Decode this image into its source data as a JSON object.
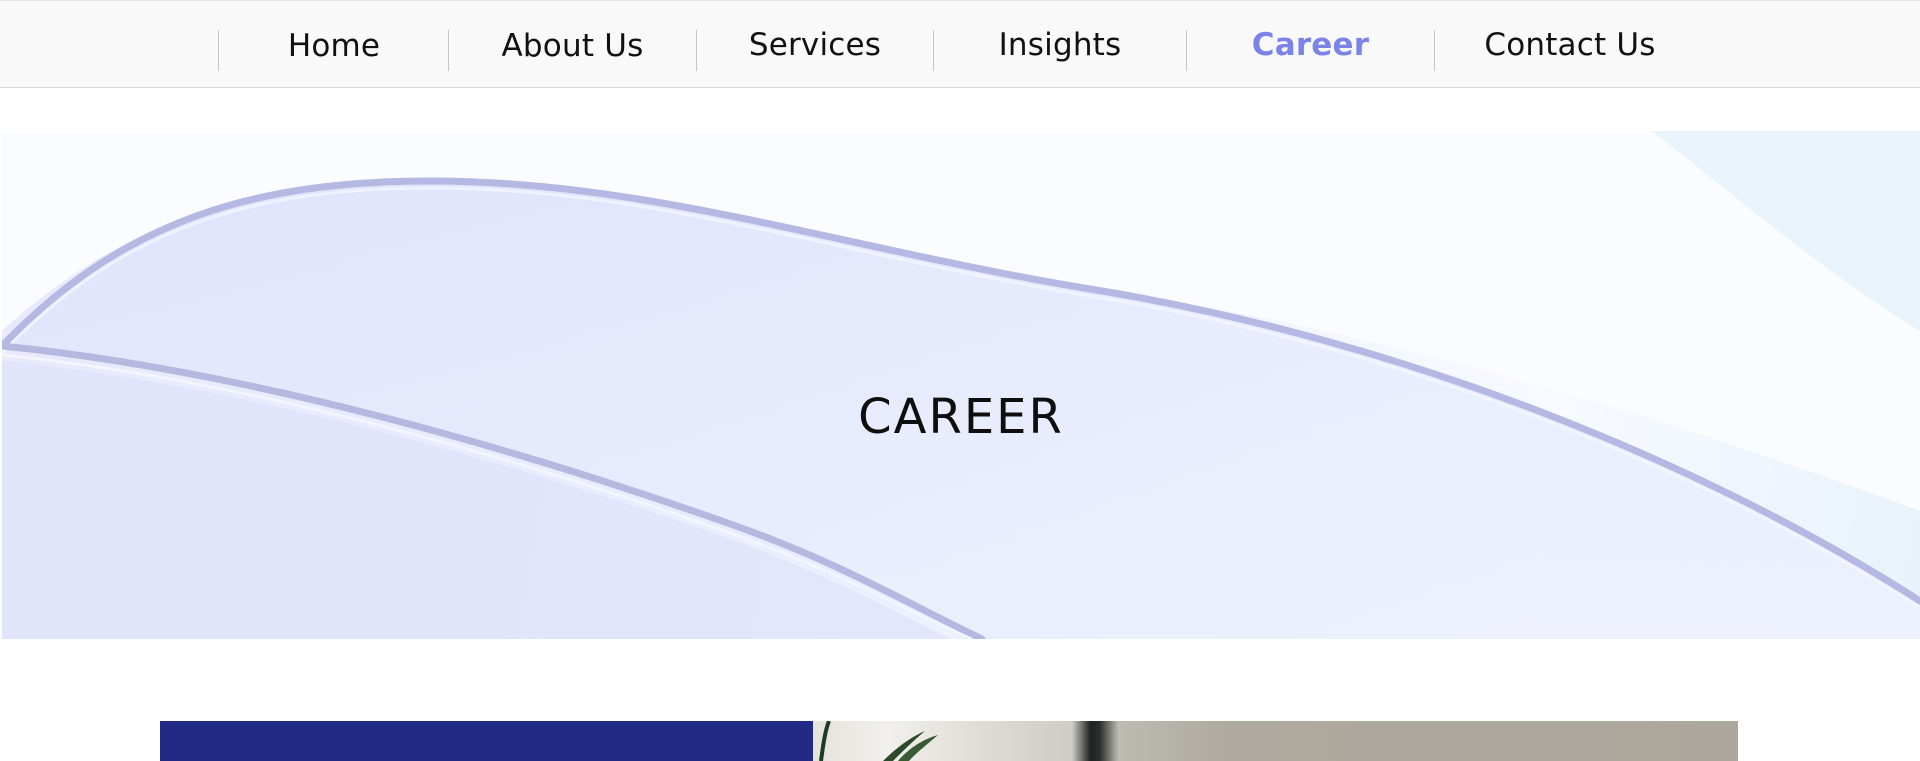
{
  "nav": {
    "items": [
      {
        "label": "Home",
        "active": false
      },
      {
        "label": "About Us",
        "active": false
      },
      {
        "label": "Services",
        "active": false
      },
      {
        "label": "Insights",
        "active": false
      },
      {
        "label": "Career",
        "active": true
      },
      {
        "label": "Contact Us",
        "active": false
      }
    ],
    "colors": {
      "text": "#111111",
      "active": "#7b82e8",
      "background": "#f9f9f9"
    }
  },
  "hero": {
    "title": "CAREER"
  },
  "colors": {
    "content_block": "#212b85"
  }
}
